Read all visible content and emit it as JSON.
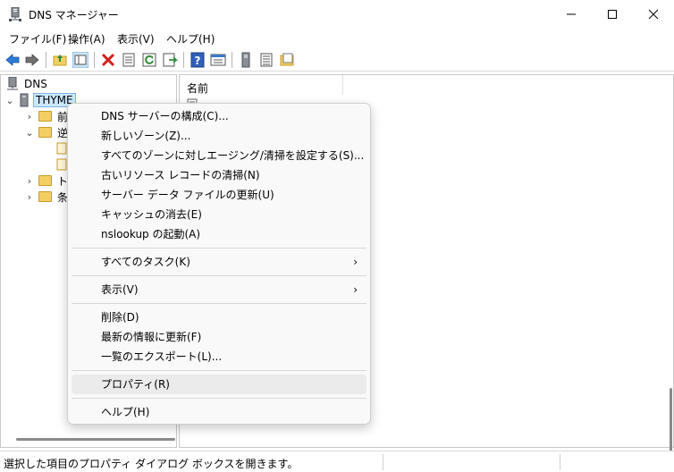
{
  "window": {
    "title": "DNS マネージャー",
    "minimize_glyph": "—",
    "maximize_glyph": "☐",
    "close_glyph": "✕"
  },
  "menubar": [
    "ファイル(F)",
    "操作(A)",
    "表示(V)",
    "ヘルプ(H)"
  ],
  "toolbar": {
    "icons": [
      "back-arrow-icon",
      "forward-arrow-icon",
      "up-folder-icon",
      "show-hide-tree-icon",
      "delete-icon",
      "properties-icon",
      "refresh-icon",
      "export-list-icon",
      "help-icon",
      "console-icon",
      "server-icon",
      "list-icon",
      "folder-icon"
    ]
  },
  "tree": {
    "root": "DNS",
    "server": "THYME",
    "items": [
      "前",
      "逆",
      "ト",
      "条"
    ]
  },
  "list": {
    "column_name": "名前"
  },
  "context_menu": {
    "items": [
      {
        "label": "DNS サーバーの構成(C)..."
      },
      {
        "label": "新しいゾーン(Z)..."
      },
      {
        "label": "すべてのゾーンに対しエージング/清掃を設定する(S)..."
      },
      {
        "label": "古いリソース レコードの清掃(N)"
      },
      {
        "label": "サーバー データ ファイルの更新(U)"
      },
      {
        "label": "キャッシュの消去(E)"
      },
      {
        "label": "nslookup の起動(A)"
      },
      {
        "label": "すべてのタスク(K)",
        "submenu": true
      },
      {
        "label": "表示(V)",
        "submenu": true
      },
      {
        "label": "削除(D)"
      },
      {
        "label": "最新の情報に更新(F)"
      },
      {
        "label": "一覧のエクスポート(L)..."
      },
      {
        "label": "プロパティ(R)",
        "highlighted": true
      },
      {
        "label": "ヘルプ(H)"
      }
    ],
    "submenu_arrow": "›"
  },
  "status": {
    "text": "選択した項目のプロパティ ダイアログ ボックスを開きます。"
  },
  "colors": {
    "selection": "#cce8ff",
    "folder": "#f3cf63",
    "accent_blue": "#1e6fd9"
  }
}
